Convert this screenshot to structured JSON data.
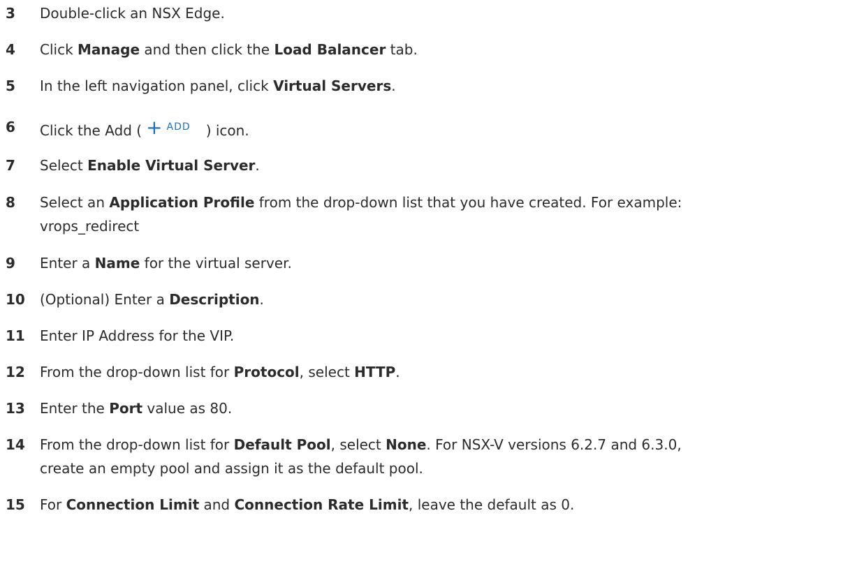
{
  "steps": [
    {
      "num": "3",
      "parts": [
        {
          "t": "Double-click an NSX Edge.",
          "b": false
        }
      ]
    },
    {
      "num": "4",
      "parts": [
        {
          "t": "Click ",
          "b": false
        },
        {
          "t": "Manage",
          "b": true
        },
        {
          "t": " and then click the ",
          "b": false
        },
        {
          "t": "Load Balancer",
          "b": true
        },
        {
          "t": " tab.",
          "b": false
        }
      ]
    },
    {
      "num": "5",
      "parts": [
        {
          "t": "In the left navigation panel, click ",
          "b": false
        },
        {
          "t": "Virtual Servers",
          "b": true
        },
        {
          "t": ".",
          "b": false
        }
      ]
    },
    {
      "num": "6",
      "before": "Click the Add (",
      "add_icon": "plus-icon",
      "add_label": "ADD",
      "after": ") icon."
    },
    {
      "num": "7",
      "parts": [
        {
          "t": "Select ",
          "b": false
        },
        {
          "t": "Enable Virtual Server",
          "b": true
        },
        {
          "t": ".",
          "b": false
        }
      ]
    },
    {
      "num": "8",
      "parts": [
        {
          "t": "Select an ",
          "b": false
        },
        {
          "t": "Application Profile",
          "b": true
        },
        {
          "t": " from the drop-down list that you have created. For example:",
          "b": false
        }
      ],
      "line2": "vrops_redirect"
    },
    {
      "num": "9",
      "parts": [
        {
          "t": "Enter a ",
          "b": false
        },
        {
          "t": "Name",
          "b": true
        },
        {
          "t": " for the virtual server.",
          "b": false
        }
      ]
    },
    {
      "num": "10",
      "parts": [
        {
          "t": "(Optional) Enter a ",
          "b": false
        },
        {
          "t": "Description",
          "b": true
        },
        {
          "t": ".",
          "b": false
        }
      ]
    },
    {
      "num": "11",
      "parts": [
        {
          "t": "Enter IP Address for the VIP.",
          "b": false
        }
      ]
    },
    {
      "num": "12",
      "parts": [
        {
          "t": "From the drop-down list for ",
          "b": false
        },
        {
          "t": "Protocol",
          "b": true
        },
        {
          "t": ", select ",
          "b": false
        },
        {
          "t": "HTTP",
          "b": true
        },
        {
          "t": ".",
          "b": false
        }
      ]
    },
    {
      "num": "13",
      "parts": [
        {
          "t": "Enter the ",
          "b": false
        },
        {
          "t": "Port",
          "b": true
        },
        {
          "t": " value as 80.",
          "b": false
        }
      ]
    },
    {
      "num": "14",
      "parts": [
        {
          "t": "From the drop-down list for ",
          "b": false
        },
        {
          "t": "Default Pool",
          "b": true
        },
        {
          "t": ", select ",
          "b": false
        },
        {
          "t": "None",
          "b": true
        },
        {
          "t": ". For NSX-V versions 6.2.7 and 6.3.0,",
          "b": false
        }
      ],
      "line2": "create an empty pool and assign it as the default pool."
    },
    {
      "num": "15",
      "parts": [
        {
          "t": "For ",
          "b": false
        },
        {
          "t": "Connection Limit",
          "b": true
        },
        {
          "t": " and ",
          "b": false
        },
        {
          "t": "Connection Rate Limit",
          "b": true
        },
        {
          "t": ", leave the default as 0.",
          "b": false
        }
      ]
    }
  ],
  "colors": {
    "text": "#2b2b2b",
    "add_accent": "#1f6fbf"
  }
}
